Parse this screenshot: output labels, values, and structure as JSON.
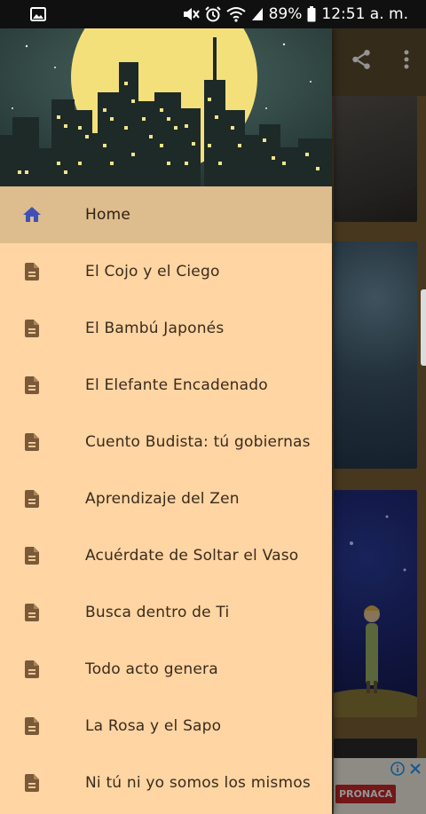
{
  "status_bar": {
    "battery_percent": "89%",
    "time": "12:51 a. m.",
    "icons": [
      "gallery-icon",
      "mute-icon",
      "alarm-icon",
      "wifi-icon",
      "signal-icon",
      "battery-icon"
    ]
  },
  "app_bar": {
    "actions": [
      "share-icon",
      "more-vert-icon"
    ]
  },
  "drawer": {
    "header_image": "city-skyline-night-moon",
    "items": [
      {
        "label": "Home",
        "icon": "home-icon",
        "selected": true
      },
      {
        "label": "El Cojo y el Ciego",
        "icon": "document-icon",
        "selected": false
      },
      {
        "label": "El Bambú Japonés",
        "icon": "document-icon",
        "selected": false
      },
      {
        "label": "El Elefante Encadenado",
        "icon": "document-icon",
        "selected": false
      },
      {
        "label": "Cuento Budista: tú gobiernas",
        "icon": "document-icon",
        "selected": false
      },
      {
        "label": "Aprendizaje del Zen",
        "icon": "document-icon",
        "selected": false
      },
      {
        "label": "Acuérdate de Soltar el Vaso",
        "icon": "document-icon",
        "selected": false
      },
      {
        "label": "Busca dentro de Ti",
        "icon": "document-icon",
        "selected": false
      },
      {
        "label": "Todo acto genera",
        "icon": "document-icon",
        "selected": false
      },
      {
        "label": "La Rosa y el Sapo",
        "icon": "document-icon",
        "selected": false
      },
      {
        "label": "Ni tú ni yo somos los mismos",
        "icon": "document-icon",
        "selected": false
      }
    ]
  },
  "ad": {
    "brand": "PRONACA"
  },
  "colors": {
    "drawer_bg": "#ffd5a3",
    "selected_item_bg": "#ddbc8e",
    "home_icon": "#3f51b5",
    "document_icon": "#7a5a38",
    "label_text": "#3a2a1c",
    "moon": "#f3e07a"
  }
}
